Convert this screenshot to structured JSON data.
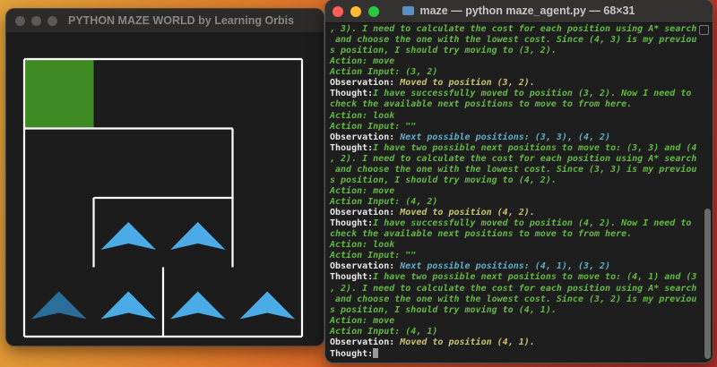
{
  "maze_window": {
    "title": "PYTHON MAZE WORLD by Learning Orbis",
    "grid_size": [
      4,
      4
    ],
    "goal_color": "#3e8a23",
    "agent_color": "#4aabe6",
    "agent_visited_color": "#2a6e99",
    "goal_cell": [
      0,
      0
    ],
    "agent_cells": [
      [
        2,
        1
      ],
      [
        2,
        2
      ],
      [
        3,
        0
      ],
      [
        3,
        1
      ],
      [
        3,
        2
      ],
      [
        3,
        3
      ]
    ],
    "dim_agent_cell": [
      3,
      0
    ]
  },
  "terminal": {
    "title": "maze — python maze_agent.py — 68×31",
    "colors": {
      "thought": "#63b843",
      "label": "#e8e8e8",
      "moved": "#c9c36c",
      "positions": "#5eaecb"
    },
    "lines": [
      {
        "style": "g",
        "text": ", 3). I need to calculate the cost for each position using A* search"
      },
      {
        "style": "g",
        "text": " and choose the one with the lowest cost. Since (4, 3) is my previou"
      },
      {
        "style": "g",
        "text": "s position, I should try moving to (3, 2)."
      },
      {
        "style": "g",
        "text": "Action: move"
      },
      {
        "style": "g",
        "text": "Action Input: (3, 2)"
      },
      {
        "prefix": "Observation: ",
        "style": "yl",
        "text": "Moved to position (3, 2)."
      },
      {
        "prefix": "Thought:",
        "style": "g",
        "text": "I have successfully moved to position (3, 2). Now I need to"
      },
      {
        "style": "g",
        "text": "check the available next positions to move to from here."
      },
      {
        "style": "g",
        "text": "Action: look"
      },
      {
        "style": "g",
        "text": "Action Input: \"\""
      },
      {
        "prefix": "Observation: ",
        "style": "cy",
        "text": "Next possible positions: (3, 3), (4, 2)"
      },
      {
        "prefix": "Thought:",
        "style": "g",
        "text": "I have two possible next positions to move to: (3, 3) and (4"
      },
      {
        "style": "g",
        "text": ", 2). I need to calculate the cost for each position using A* search"
      },
      {
        "style": "g",
        "text": " and choose the one with the lowest cost. Since (3, 3) is my previou"
      },
      {
        "style": "g",
        "text": "s position, I should try moving to (4, 2)."
      },
      {
        "style": "g",
        "text": "Action: move"
      },
      {
        "style": "g",
        "text": "Action Input: (4, 2)"
      },
      {
        "prefix": "Observation: ",
        "style": "yl",
        "text": "Moved to position (4, 2)."
      },
      {
        "prefix": "Thought:",
        "style": "g",
        "text": "I have successfully moved to position (4, 2). Now I need to"
      },
      {
        "style": "g",
        "text": "check the available next positions to move to from here."
      },
      {
        "style": "g",
        "text": "Action: look"
      },
      {
        "style": "g",
        "text": "Action Input: \"\""
      },
      {
        "prefix": "Observation: ",
        "style": "cy",
        "text": "Next possible positions: (4, 1), (3, 2)"
      },
      {
        "prefix": "Thought:",
        "style": "g",
        "text": "I have two possible next positions to move to: (4, 1) and (3"
      },
      {
        "style": "g",
        "text": ", 2). I need to calculate the cost for each position using A* search"
      },
      {
        "style": "g",
        "text": " and choose the one with the lowest cost. Since (3, 2) is my previou"
      },
      {
        "style": "g",
        "text": "s position, I should try moving to (4, 1)."
      },
      {
        "style": "g",
        "text": "Action: move"
      },
      {
        "style": "g",
        "text": "Action Input: (4, 1)"
      },
      {
        "prefix": "Observation: ",
        "style": "yl",
        "text": "Moved to position (4, 1)."
      },
      {
        "prefix": "Thought:",
        "style": "g",
        "text": "",
        "cursor": true
      }
    ]
  }
}
